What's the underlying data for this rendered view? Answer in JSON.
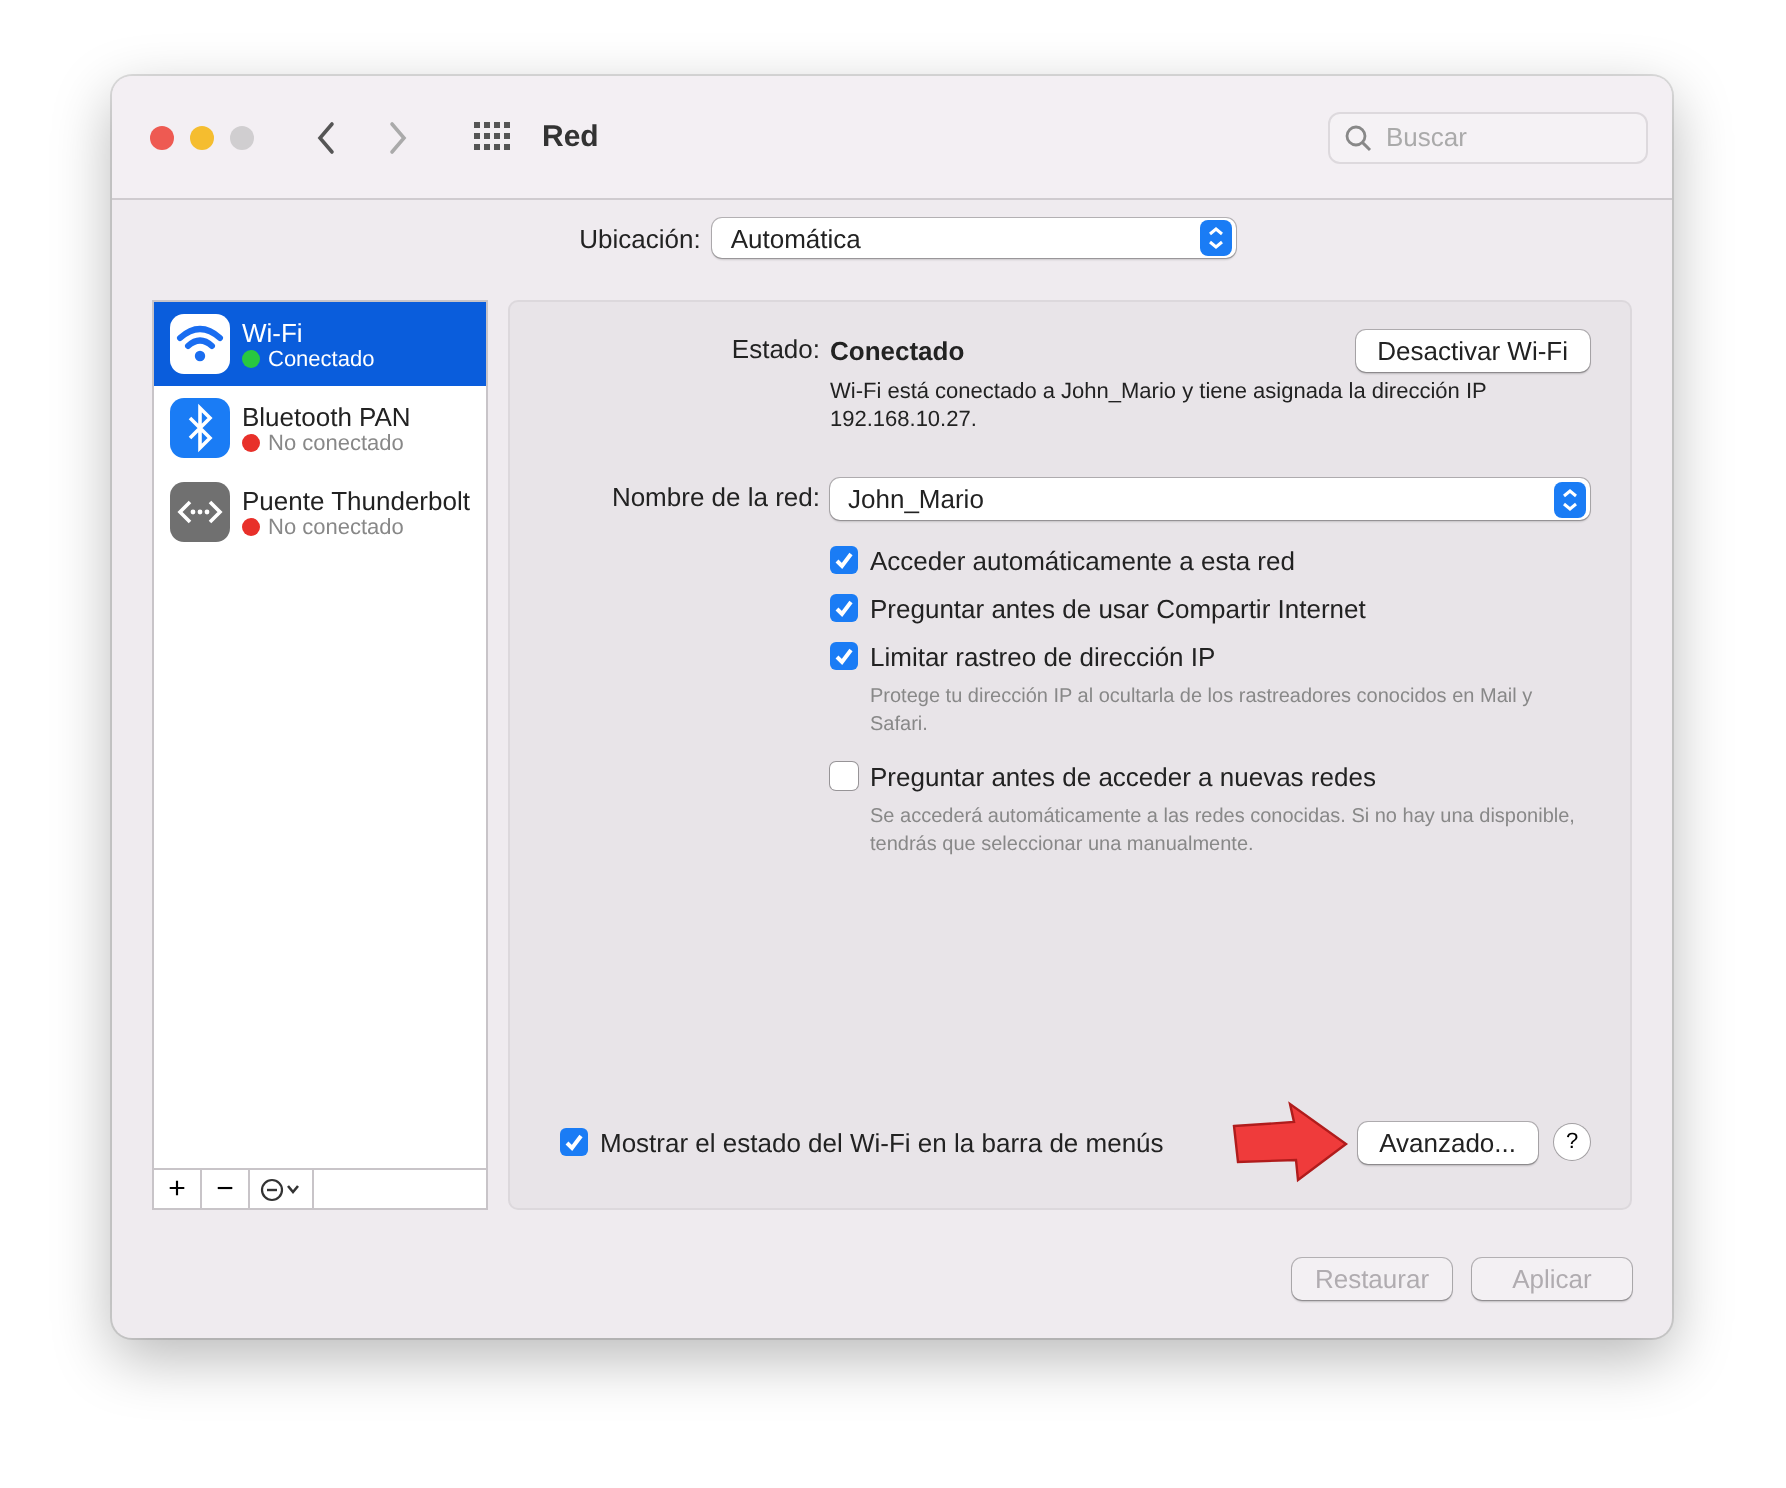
{
  "window": {
    "title": "Red",
    "search": {
      "placeholder": "Buscar"
    }
  },
  "location": {
    "label": "Ubicación:",
    "value": "Automática"
  },
  "services": [
    {
      "kind": "wifi",
      "name": "Wi-Fi",
      "status": "Conectado",
      "color": "#28c840",
      "selected": true
    },
    {
      "kind": "bluetooth",
      "name": "Bluetooth PAN",
      "status": "No conectado",
      "color": "#e8302a",
      "selected": false
    },
    {
      "kind": "thunderbolt",
      "name": "Puente Thunderbolt",
      "status": "No conectado",
      "color": "#e8302a",
      "selected": false
    }
  ],
  "sidebar_tools": [
    "+",
    "−"
  ],
  "status": {
    "label": "Estado:",
    "value": "Conectado",
    "button": "Desactivar Wi-Fi",
    "description": "Wi-Fi está conectado a John_Mario y tiene asignada la dirección IP 192.168.10.27."
  },
  "network": {
    "label": "Nombre de la red:",
    "value": "John_Mario"
  },
  "options": [
    {
      "label": "Acceder automáticamente a esta red",
      "checked": true
    },
    {
      "label": "Preguntar antes de usar Compartir Internet",
      "checked": true
    },
    {
      "label": "Limitar rastreo de dirección IP",
      "checked": true,
      "note": "Protege tu dirección IP al ocultarla de los rastreadores conocidos en Mail y Safari."
    },
    {
      "label": "Preguntar antes de acceder a nuevas redes",
      "checked": false,
      "note": "Se accederá automáticamente a las redes conocidas. Si no hay una disponible, tendrás que seleccionar una manualmente."
    }
  ],
  "menu_bar_option": {
    "label": "Mostrar el estado del Wi-Fi en la barra de menús",
    "checked": true
  },
  "advanced_button": "Avanzado...",
  "help_button": "?",
  "footer_buttons": [
    {
      "label": "Restaurar",
      "disabled": true
    },
    {
      "label": "Aplicar",
      "disabled": true
    }
  ]
}
